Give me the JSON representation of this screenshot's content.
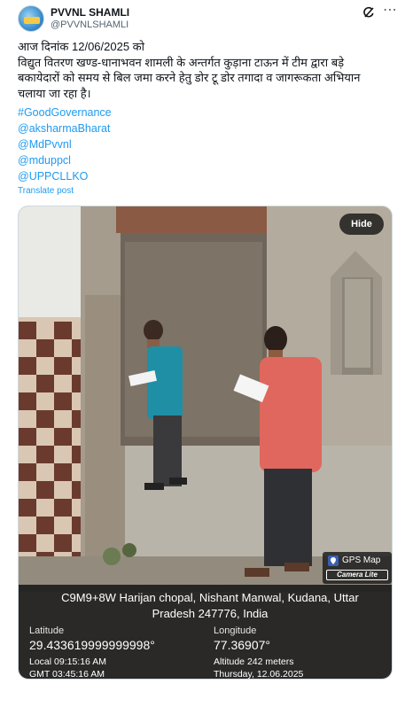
{
  "header": {
    "name": "PVVNL SHAMLI",
    "handle": "@PVVNLSHAMLI",
    "grok_icon": "grok-icon",
    "more_icon": "more-icon"
  },
  "tweet": {
    "lines": [
      "आज दिनांक 12/06/2025 को",
      "विद्युत वितरण खण्ड-धानाभवन शामली के अन्तर्गत कुड़ाना टाऊन में टीम द्वारा बड़े",
      "बकायेदारों को समय से बिल जमा करने हेतु डोर टू डोर तगादा व जागरूकता अभियान",
      "चलाया जा रहा है।"
    ],
    "hashtags": [
      "#GoodGovernance",
      "@aksharmaBharat",
      "@MdPvvnl",
      "@mduppcl",
      "@UPPCLLKO"
    ],
    "translate_label": "Translate post"
  },
  "media": {
    "hide_label": "Hide",
    "gps_badge": {
      "title": "GPS Map",
      "subtitle": "Camera Lite"
    },
    "geo": {
      "address_line1": "C9M9+8W Harijan chopal, Nishant Manwal, Kudana, Uttar",
      "address_line2": "Pradesh 247776, India",
      "latitude_label": "Latitude",
      "latitude_value": "29.433619999999998°",
      "longitude_label": "Longitude",
      "longitude_value": "77.36907°",
      "local_time": "Local 09:15:16 AM",
      "gmt_time": "GMT 03:45:16 AM",
      "altitude": "Altitude 242 meters",
      "date": "Thursday, 12.06.2025"
    }
  },
  "colors": {
    "link": "#1d9bf0",
    "text": "#0f1419",
    "muted": "#536471"
  }
}
